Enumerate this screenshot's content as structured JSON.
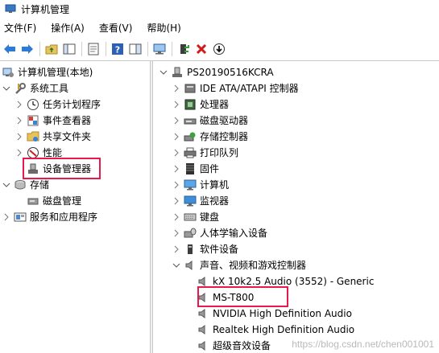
{
  "window": {
    "title": "计算机管理"
  },
  "menu": [
    "文件(F)",
    "操作(A)",
    "查看(V)",
    "帮助(H)"
  ],
  "left_tree": {
    "root": "计算机管理(本地)",
    "system_tools": "系统工具",
    "task_scheduler": "任务计划程序",
    "event_viewer": "事件查看器",
    "shared_folders": "共享文件夹",
    "performance": "性能",
    "device_manager": "设备管理器",
    "storage": "存储",
    "disk_management": "磁盘管理",
    "services_apps": "服务和应用程序"
  },
  "right_tree": {
    "computer": "PS20190516KCRA",
    "categories": [
      "IDE ATA/ATAPI 控制器",
      "处理器",
      "磁盘驱动器",
      "存储控制器",
      "打印队列",
      "固件",
      "计算机",
      "监视器",
      "键盘",
      "人体学输入设备",
      "软件设备"
    ],
    "audio_category": "声音、视频和游戏控制器",
    "audio_devices": [
      "kX 10k2.5 Audio (3552) - Generic",
      "MS-T800",
      "NVIDIA High Definition Audio",
      "Realtek High Definition Audio",
      "超级音效设备"
    ]
  },
  "watermark": "https://blog.csdn.net/chen001001",
  "colors": {
    "highlight_box": "#e8194b"
  }
}
